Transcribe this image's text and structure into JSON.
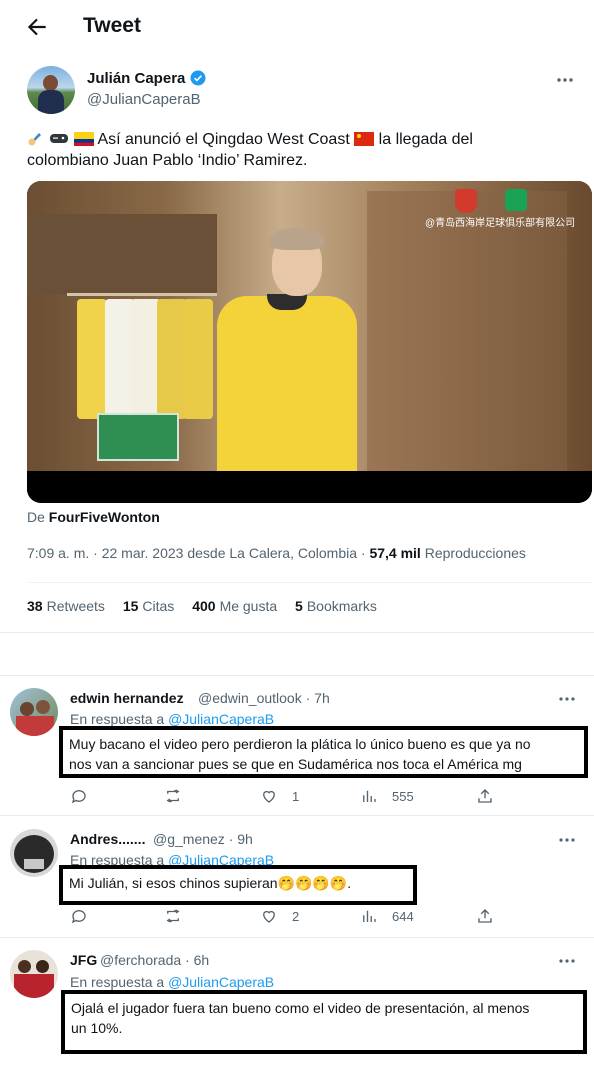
{
  "header": {
    "title": "Tweet",
    "back_icon": "arrow-left-icon"
  },
  "author": {
    "name": "Julián Capera",
    "handle": "@JulianCaperaB",
    "verified_color": "#1d9bf0"
  },
  "tweet": {
    "emojis": [
      "writing-hand-icon",
      "game-controller-icon",
      "colombia-flag-icon"
    ],
    "text_part1": "Así anunció el Qingdao West Coast",
    "flag2": "china-flag-icon",
    "text_part2": "la llegada del",
    "text_line2": "colombiano Juan Pablo ‘Indio’ Ramirez."
  },
  "media": {
    "watermark": "@青岛西海岸足球俱乐部有限公司"
  },
  "source": {
    "prefix": "De",
    "name": "FourFiveWonton"
  },
  "meta": {
    "time": "7:09 a. m.",
    "sep1": "·",
    "date": "22 mar. 2023",
    "location": "desde La Calera, Colombia",
    "sep2": "·",
    "views": "57,4 mil",
    "views_label": "Reproducciones"
  },
  "stats": [
    {
      "value": "38",
      "label": "Retweets"
    },
    {
      "value": "15",
      "label": "Citas"
    },
    {
      "value": "400",
      "label": "Me gusta"
    },
    {
      "value": "5",
      "label": "Bookmarks"
    }
  ],
  "replies": [
    {
      "name": "edwin hernandez",
      "handle": "@edwin_outlook",
      "time": "· 7h",
      "in_reply_prefix": "En respuesta a",
      "in_reply_handle": "@JulianCaperaB",
      "text_line1": "Muy bacano el video pero perdieron la plática lo único bueno es que ya no",
      "text_line2": "nos van a sancionar pues se que en Sudamérica nos toca el América mg",
      "likes": "1",
      "views": "555"
    },
    {
      "name": "Andres.......",
      "handle": "@g_menez",
      "time": "· 9h",
      "in_reply_prefix": "En respuesta a",
      "in_reply_handle": "@JulianCaperaB",
      "text_line1": "Mi Julián, si esos chinos supieran🤭🤭🤭🤭.",
      "likes": "2",
      "views": "644"
    },
    {
      "name": "JFG",
      "handle": "@ferchorada",
      "time": "· 6h",
      "in_reply_prefix": "En respuesta a",
      "in_reply_handle": "@JulianCaperaB",
      "text_line1": "Ojalá el jugador fuera tan bueno como el video de presentación, al menos",
      "text_line2": "un 10%."
    }
  ]
}
